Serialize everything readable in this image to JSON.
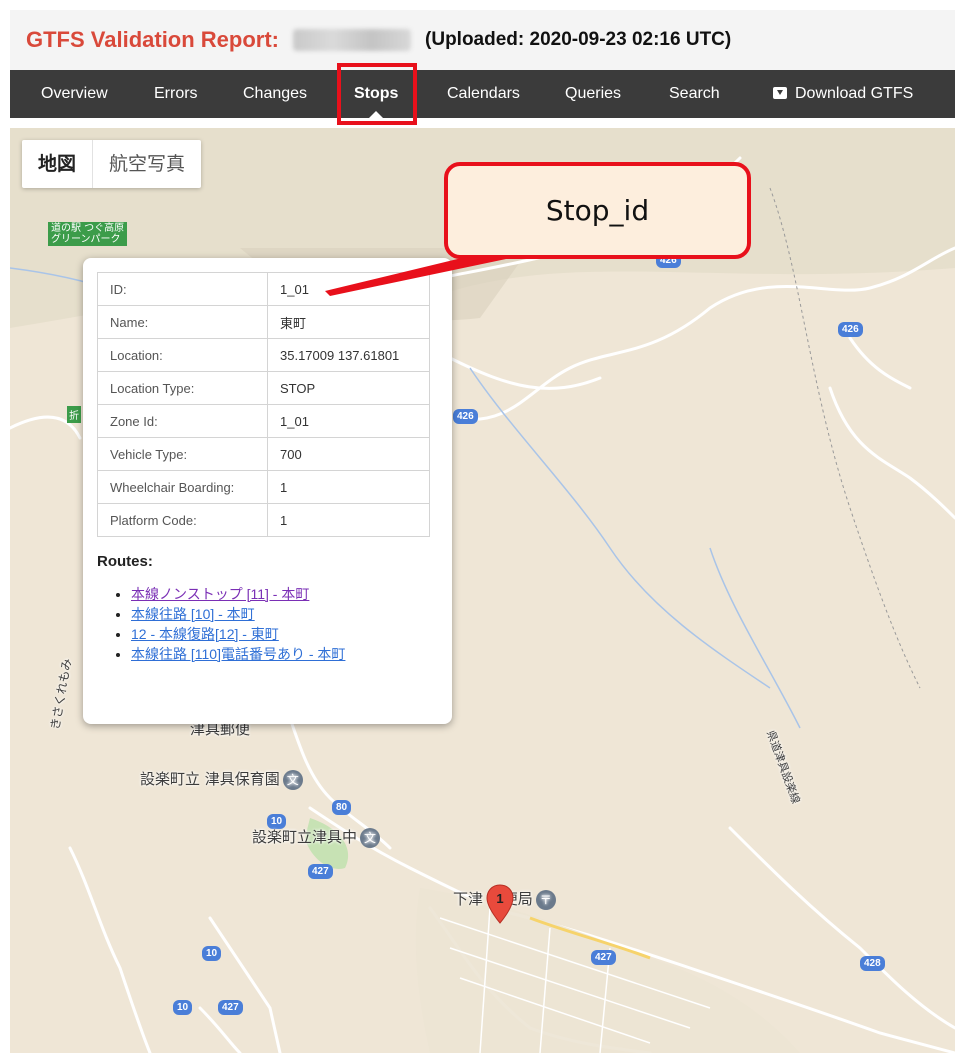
{
  "header": {
    "title": "GTFS Validation Report:",
    "uploaded": "(Uploaded: 2020-09-23 02:16 UTC)"
  },
  "nav": {
    "items": [
      {
        "label": "Overview"
      },
      {
        "label": "Errors"
      },
      {
        "label": "Changes"
      },
      {
        "label": "Stops",
        "active": true
      },
      {
        "label": "Calendars"
      },
      {
        "label": "Queries"
      },
      {
        "label": "Search"
      },
      {
        "label": "Download GTFS",
        "icon": "download-icon"
      }
    ]
  },
  "map": {
    "type_buttons": [
      "地図",
      "航空写真"
    ],
    "labels": {
      "green_poi": "道の駅 つぐ高原\nグリーンパーク",
      "tsugu_post": "津具郵便",
      "nursery": "設楽町立 津具保育園",
      "middle_school": "設楽町立津具中",
      "shimotsugu_post": "下津  郵便局",
      "road_side": "きさくれもみ",
      "road_right": "県道津具設楽線",
      "ori": "折"
    },
    "route_badges": [
      "426",
      "426",
      "426",
      "80",
      "10",
      "427",
      "427",
      "10",
      "10",
      "427",
      "428"
    ],
    "marker_label": "1"
  },
  "info_window": {
    "rows": [
      {
        "key": "ID:",
        "value": "1_01"
      },
      {
        "key": "Name:",
        "value": "東町"
      },
      {
        "key": "Location:",
        "value": "35.17009 137.61801"
      },
      {
        "key": "Location Type:",
        "value": "STOP"
      },
      {
        "key": "Zone Id:",
        "value": "1_01"
      },
      {
        "key": "Vehicle Type:",
        "value": "700"
      },
      {
        "key": "Wheelchair Boarding:",
        "value": "1"
      },
      {
        "key": "Platform Code:",
        "value": "1"
      }
    ],
    "routes_title": "Routes:",
    "routes": [
      {
        "label": "本線ノンストップ [11] - 本町",
        "visited": true
      },
      {
        "label": "本線往路 [10] - 本町",
        "visited": false
      },
      {
        "label": "12 - 本線復路[12] - 東町",
        "visited": false
      },
      {
        "label": "本線往路 [110]電話番号あり - 本町",
        "visited": false
      }
    ]
  },
  "callout": {
    "text": "Stop_id"
  },
  "colors": {
    "title_red": "#d9493a",
    "nav_bg": "#3b3b3b",
    "highlight_red": "#e8101b",
    "link_blue": "#2f6fd6",
    "link_visited": "#7a2fb5",
    "callout_bg": "#fdeedd"
  }
}
